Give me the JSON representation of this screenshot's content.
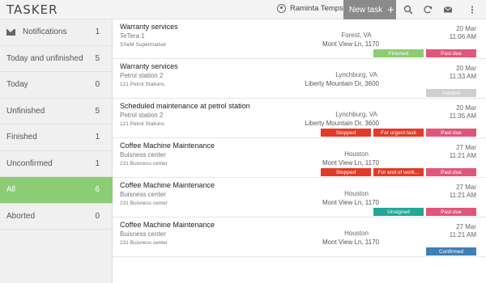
{
  "app": {
    "logo": "TASKER"
  },
  "header": {
    "user_name": "Raminta Temps",
    "new_task_label": "New task",
    "icons": [
      "user-icon",
      "plus-icon",
      "search-icon",
      "refresh-icon",
      "mail-icon",
      "more-vert-icon"
    ]
  },
  "sidebar": {
    "items": [
      {
        "label": "Notifications",
        "count": "1",
        "icon": "mail-icon"
      },
      {
        "label": "Today and unfinished",
        "count": "5"
      },
      {
        "label": "Today",
        "count": "0"
      },
      {
        "label": "Unfinished",
        "count": "5"
      },
      {
        "label": "Finished",
        "count": "1"
      },
      {
        "label": "Unconfirmed",
        "count": "1"
      },
      {
        "label": "All",
        "count": "6",
        "active": true
      },
      {
        "label": "Aborted",
        "count": "0"
      }
    ]
  },
  "tasks": [
    {
      "title": "Warranty services",
      "client": "TeTera 1",
      "site": "SSeM Supermarket",
      "city": "Forest, VA",
      "address": "Mont View Ln, 1170",
      "date": "20 Mar",
      "time": "11:06 AM",
      "badges": [
        {
          "label": "Finished",
          "color": "#8ccc74"
        },
        {
          "label": "Past due",
          "color": "#e0567a"
        }
      ]
    },
    {
      "title": "Warranty services",
      "client": "Petrol station 2",
      "site": "121 Petrol Stations",
      "city": "Lynchburg, VA",
      "address": "Liberty Mountain Dr, 3600",
      "date": "20 Mar",
      "time": "11:33 AM",
      "badges": [
        {
          "label": "Inactive",
          "color": "#cfcfcf"
        }
      ]
    },
    {
      "title": "Scheduled maintenance at petrol station",
      "client": "Petrol station 2",
      "site": "121 Petrol Stations",
      "city": "Lynchburg, VA",
      "address": "Liberty Mountain Dr, 3600",
      "date": "20 Mar",
      "time": "11:35 AM",
      "badges": [
        {
          "label": "Stopped",
          "color": "#e33a27"
        },
        {
          "label": "For urgent task",
          "color": "#e33a27"
        },
        {
          "label": "Past due",
          "color": "#e0567a"
        }
      ]
    },
    {
      "title": "Coffee Machine Maintenance",
      "client": "Buisness center",
      "site": "231 Buisness center",
      "city": "Houston",
      "address": "Mont View Ln, 1170",
      "date": "27 Mar",
      "time": "11:21 AM",
      "badges": [
        {
          "label": "Stopped",
          "color": "#e33a27"
        },
        {
          "label": "For end of work...",
          "color": "#e33a27"
        },
        {
          "label": "Past due",
          "color": "#e0567a"
        }
      ]
    },
    {
      "title": "Coffee Machine Maintenance",
      "client": "Buisness center",
      "site": "231 Buisness center",
      "city": "Houston",
      "address": "Mont View Ln, 1170",
      "date": "27 Mar",
      "time": "11:21 AM",
      "badges": [
        {
          "label": "Unsigned",
          "color": "#22a896"
        },
        {
          "label": "Past due",
          "color": "#e0567a"
        }
      ]
    },
    {
      "title": "Coffee Machine Maintenance",
      "client": "Buisness center",
      "site": "231 Buisness center",
      "city": "Houston",
      "address": "Mont View Ln, 1170",
      "date": "27 Mar",
      "time": "11:21 AM",
      "badges": [
        {
          "label": "Confirmed",
          "color": "#3f7fb5"
        }
      ]
    }
  ]
}
